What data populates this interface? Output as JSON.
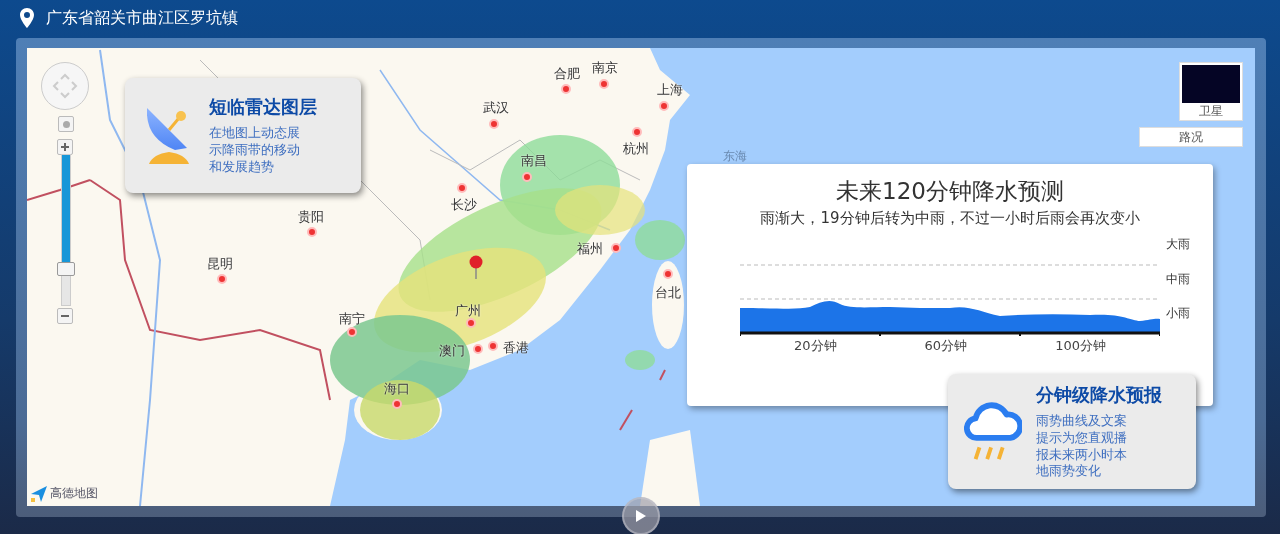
{
  "header": {
    "location": "广东省韶关市曲江区罗坑镇"
  },
  "map": {
    "zoom_slider": {
      "level": 0.75
    },
    "cities": [
      {
        "name": "合肥"
      },
      {
        "name": "南京"
      },
      {
        "name": "上海"
      },
      {
        "name": "武汉"
      },
      {
        "name": "杭州"
      },
      {
        "name": "南昌"
      },
      {
        "name": "长沙"
      },
      {
        "name": "贵阳"
      },
      {
        "name": "福州"
      },
      {
        "name": "昆明"
      },
      {
        "name": "台北"
      },
      {
        "name": "南宁"
      },
      {
        "name": "广州"
      },
      {
        "name": "澳门"
      },
      {
        "name": "香港"
      },
      {
        "name": "海口"
      }
    ],
    "sea_label": "东海",
    "attribution": "高德地图",
    "layers": [
      {
        "label": "卫星",
        "kind": "thumbnail"
      },
      {
        "label": "路况",
        "kind": "button"
      }
    ]
  },
  "radar_card": {
    "title": "短临雷达图层",
    "description": "在地图上动态展示降雨带的移动和发展趋势"
  },
  "forecast_panel": {
    "title": "未来120分钟降水预测",
    "summary": "雨渐大，19分钟后转为中雨，不过一小时后雨会再次变小",
    "y_labels": [
      "大雨",
      "中雨",
      "小雨"
    ],
    "x_labels": [
      "20分钟",
      "60分钟",
      "100分钟"
    ]
  },
  "rain_card": {
    "title": "分钟级降水预报",
    "description": "雨势曲线及文案提示为您直观播报未来两小时本地雨势变化"
  }
}
